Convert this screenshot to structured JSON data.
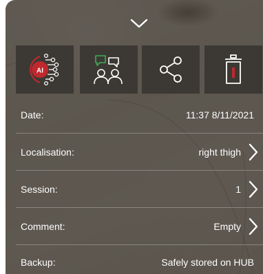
{
  "colors": {
    "panel": "#3e3a36",
    "text": "#ffffff",
    "accent_red": "#c0282d",
    "icon_green": "#3fae52"
  },
  "header": {
    "collapse_icon": "chevron-down-icon"
  },
  "toolbar": {
    "ai_icon_text": "AI",
    "buttons": [
      {
        "icon": "ai-analysis-icon"
      },
      {
        "icon": "consult-chat-icon"
      },
      {
        "icon": "share-icon"
      },
      {
        "icon": "delete-icon"
      }
    ]
  },
  "details": {
    "date": {
      "label": "Date:",
      "value": "11:37 8/11/2021"
    },
    "localisation": {
      "label": "Localisation:",
      "value": "right thigh"
    },
    "session": {
      "label": "Session:",
      "value": "1"
    },
    "comment": {
      "label": "Comment:",
      "value": "Empty"
    },
    "backup": {
      "label": "Backup:",
      "value": "Safely stored on HUB"
    }
  }
}
